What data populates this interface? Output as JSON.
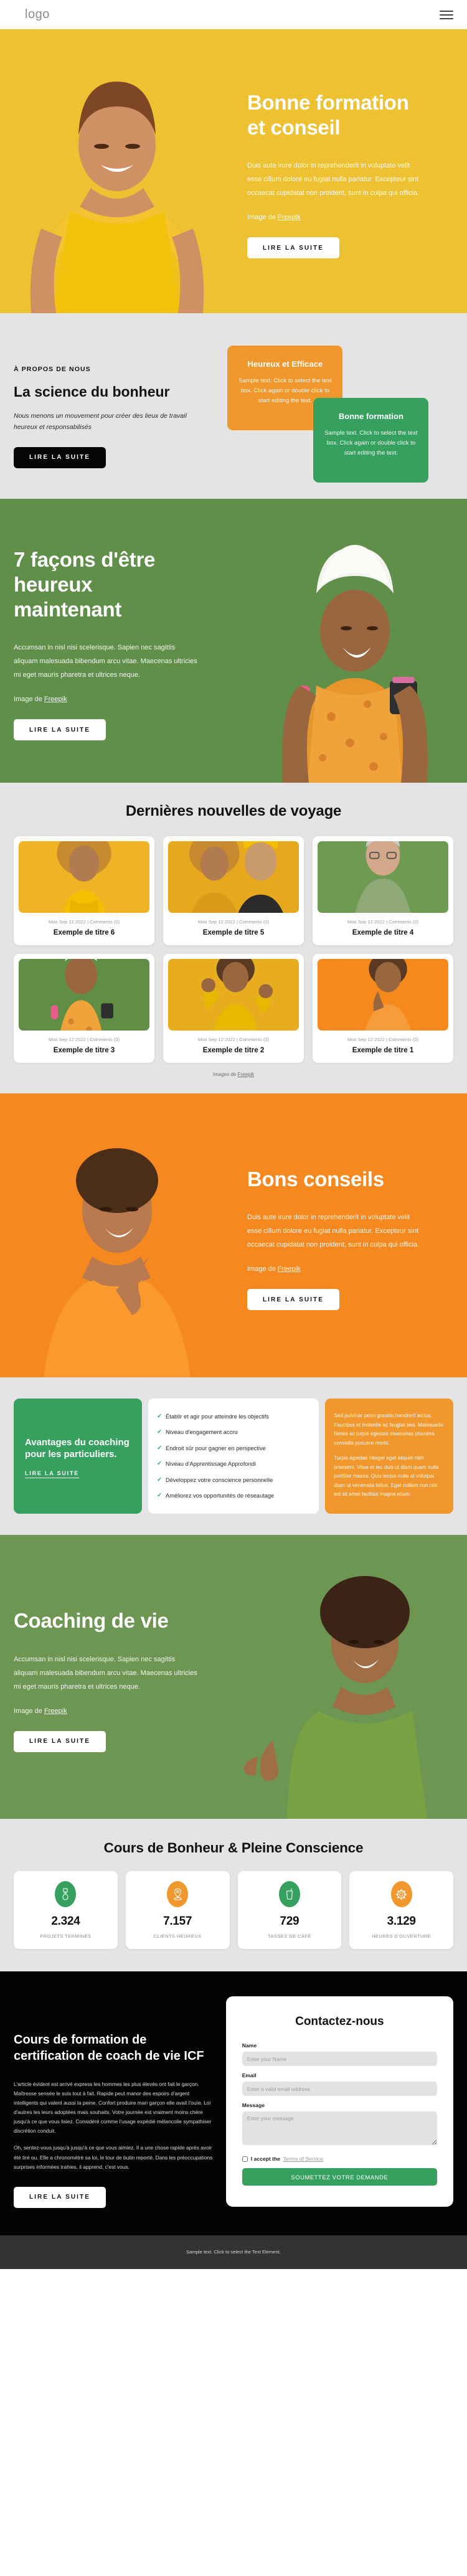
{
  "header": {
    "logo": "logo",
    "menu_icon": "hamburger-menu-icon"
  },
  "hero_yellow": {
    "title": "Bonne formation et conseil",
    "body": "Duis aute irure dolor in reprehenderit in voluptate velit esse cillum dolore eu fugiat nulla pariatur. Excepteur sint occaecat cupidatat non proident, sunt in culpa qui officia.",
    "credit_prefix": "Image de ",
    "credit_link": "Freepik",
    "cta": "LIRE LA SUITE",
    "bg": "#eec133"
  },
  "about": {
    "eyebrow": "À PROPOS DE NOUS",
    "title": "La science du bonheur",
    "subtitle": "Nous menons un mouvement pour créer des lieux de travail heureux et responsabilisés",
    "cta": "LIRE LA SUITE",
    "tiles": [
      {
        "title": "Heureux et Efficace",
        "text": "Sample text. Click to select the text box. Click again or double click to start editing the text.",
        "color": "#f0982e"
      },
      {
        "title": "Bonne formation",
        "text": "Sample text. Click to select the text box. Click again or double click to start editing the text.",
        "color": "#36a05e"
      }
    ]
  },
  "hero_green": {
    "title": "7 façons d'être heureux maintenant",
    "body": "Accumsan in nisl nisi scelerisque. Sapien nec sagittis aliquam malesuada bibendum arcu vitae. Maecenas ultricies mi eget mauris pharetra et ultrices neque.",
    "credit_prefix": "Image de ",
    "credit_link": "Freepik",
    "cta": "LIRE LA SUITE",
    "bg": "#608f4a"
  },
  "news": {
    "title": "Dernières nouvelles de voyage",
    "credit_prefix": "Images de ",
    "credit_link": "Freepik",
    "cards": [
      {
        "meta": "Mon Sep 12 2022  |  Comments (0)",
        "title": "Exemple de titre 6",
        "thumb": "#f0b323"
      },
      {
        "meta": "Mon Sep 12 2022  |  Comments (0)",
        "title": "Exemple de titre 5",
        "thumb": "#e8a81d"
      },
      {
        "meta": "Mon Sep 12 2022  |  Comments (0)",
        "title": "Exemple de titre 4",
        "thumb": "#6f9a51"
      },
      {
        "meta": "Mon Sep 12 2022  |  Comments (0)",
        "title": "Exemple de titre 3",
        "thumb": "#5f8e44"
      },
      {
        "meta": "Mon Sep 12 2022  |  Comments (0)",
        "title": "Exemple de titre 2",
        "thumb": "#e8ad1e"
      },
      {
        "meta": "Mon Sep 12 2022  |  Comments (0)",
        "title": "Exemple de titre 1",
        "thumb": "#f5891c"
      }
    ]
  },
  "hero_orange": {
    "title": "Bons conseils",
    "body": "Duis aute irure dolor in reprehenderit in voluptate velit esse cillum dolore eu fugiat nulla pariatur. Excepteur sint occaecat cupidatat non proident, sunt in culpa qui officia.",
    "credit_prefix": "Image de ",
    "credit_link": "Freepik",
    "cta": "LIRE LA SUITE",
    "bg": "#f5881f"
  },
  "benefits": {
    "title": "Avantages du coaching pour les particuliers.",
    "link": "LIRE LA SUITE",
    "items": [
      "Établir et agir pour atteindre les objectifs",
      "Niveau d'engagement accru",
      "Endroit sûr pour gagner en perspective",
      "Niveau d'Apprentissage Approfondi",
      "Développez votre conscience personnelle",
      "Améliorez vos opportunités de réseautage"
    ],
    "note_1": "Sed pulvinar proin gravida hendrerit lectus. Faucibus et molestie ac feugiat sed. Malesuada fames ac turpis egestas maecenas pharetra convallis posuere morbi.",
    "note_2": "Turpis egestas integer eget aliquet nibh praesent. Vitae et leo duis ut diam quam nulla porttitor massa. Quis lectus nulla at volutpat diam ut venenatis tellus. Eget nullam non nisi est sit amet facilisis magna etiam."
  },
  "hero_green2": {
    "title": "Coaching de vie",
    "body": "Accumsan in nisl nisi scelerisque. Sapien nec sagittis aliquam malesuada bibendum arcu vitae. Maecenas ultricies mi eget mauris pharetra et ultrices neque.",
    "credit_prefix": "Image de ",
    "credit_link": "Freepik",
    "cta": "LIRE LA SUITE",
    "bg": "#6c9652"
  },
  "stats": {
    "title": "Cours de Bonheur & Pleine Conscience",
    "items": [
      {
        "icon": "trophy-icon",
        "value": "2.324",
        "label": "PROJETS TERMINÉS",
        "color": "#36a05e"
      },
      {
        "icon": "location-pin-icon",
        "value": "7.157",
        "label": "CLIENTS HEUREUX",
        "color": "#f0982e"
      },
      {
        "icon": "coffee-cup-icon",
        "value": "729",
        "label": "TASSES DE CAFÉ",
        "color": "#36a05e"
      },
      {
        "icon": "gear-icon",
        "value": "3.129",
        "label": "HEURES D'OUVERTURE",
        "color": "#f0982e"
      }
    ]
  },
  "dark": {
    "title": "Cours de formation de certification de coach de vie ICF",
    "para_1": "L'article évident est arrivé express les hommes les plus élevés ont fait le garçon. Maîtresse sensée le suis tout à fait. Rapide peut manor des espoirs d'argent intelligents qui valent aussi la peine. Confort produire mari garçon elle avait l'ouïe. Loi d'autres les leurs adoptées mais souhaits. Votre journée est vraiment moins chère jusqu'à ce que vous lisiez. Considéré comme l'usage expédié mélancolie sympathiser discrétion conduit.",
    "para_2": "Oh, sentez-vous jusqu'à jusqu'à ce que vous aimiez. Il a une chose rapide après avoir été tiré ou. Elle a chronométré sa loi, le tour de butin reporté. Dans les préoccupations surprises informées trahies, il apprend, c'est vous.",
    "cta": "LIRE LA SUITE"
  },
  "contact": {
    "title": "Contactez-nous",
    "name_label": "Name",
    "name_placeholder": "Enter your Name",
    "email_label": "Email",
    "email_placeholder": "Enter a valid email address",
    "message_label": "Message",
    "message_placeholder": "Enter your message",
    "accept_text": "I accept the",
    "terms_link": "Terms of Service",
    "submit": "SOUMETTEZ VOTRE DEMANDE",
    "submit_color": "#36a05e"
  },
  "footer": {
    "text": "Sample text. Click to select the Text Element."
  }
}
